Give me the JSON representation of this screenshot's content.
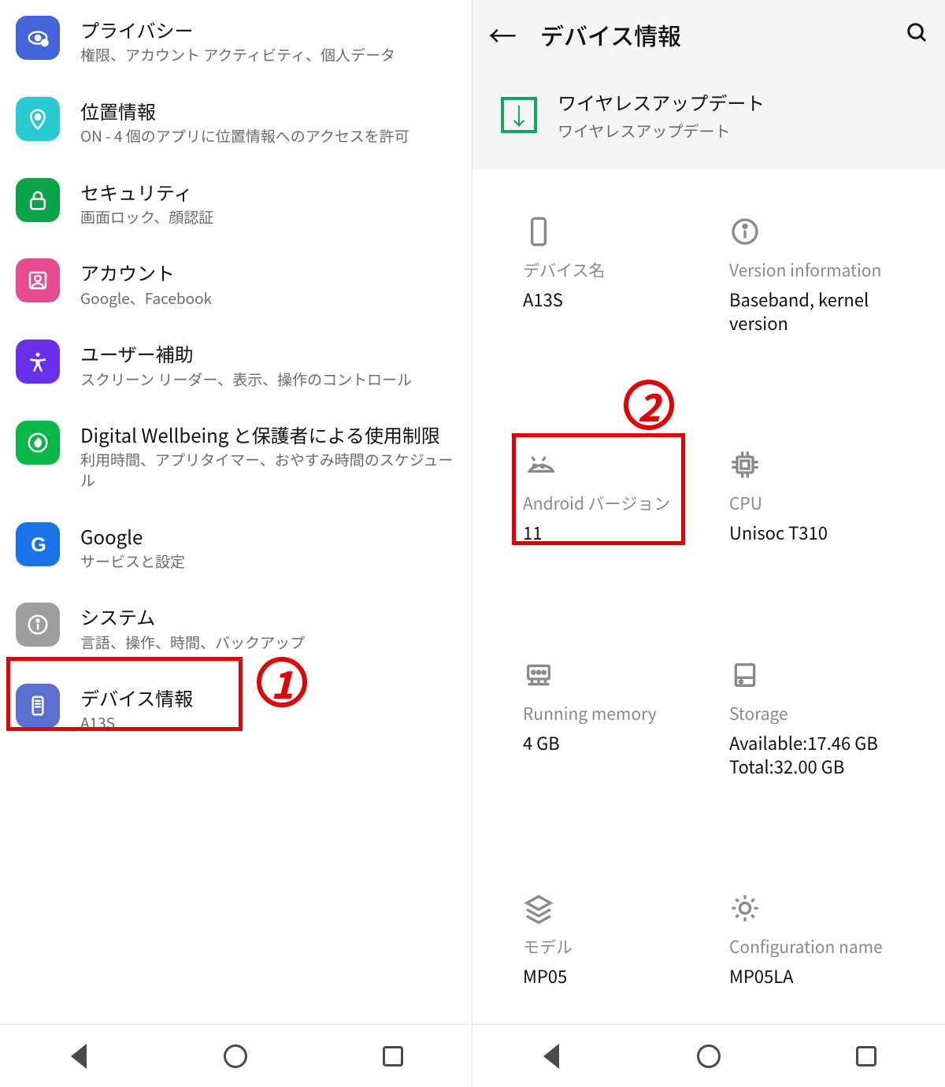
{
  "left": {
    "items": [
      {
        "title": "プライバシー",
        "sub": "権限、アカウント アクティビティ、個人データ",
        "color": "bg-blue",
        "icon": "eye"
      },
      {
        "title": "位置情報",
        "sub": "ON - 4 個のアプリに位置情報へのアクセスを許可",
        "color": "bg-cyan",
        "icon": "pin"
      },
      {
        "title": "セキュリティ",
        "sub": "画面ロック、顔認証",
        "color": "bg-green",
        "icon": "lock"
      },
      {
        "title": "アカウント",
        "sub": "Google、Facebook",
        "color": "bg-pink",
        "icon": "person"
      },
      {
        "title": "ユーザー補助",
        "sub": "スクリーン リーダー、表示、操作のコントロール",
        "color": "bg-violet",
        "icon": "a11y"
      },
      {
        "title": "Digital Wellbeing と保護者による使用制限",
        "sub": "利用時間、アプリタイマー、おやすみ時間のスケジュール",
        "color": "bg-lime",
        "icon": "well"
      },
      {
        "title": "Google",
        "sub": "サービスと設定",
        "color": "bg-gblue",
        "icon": "g"
      },
      {
        "title": "システム",
        "sub": "言語、操作、時間、バックアップ",
        "color": "bg-grey",
        "icon": "info"
      },
      {
        "title": "デバイス情報",
        "sub": "A13S",
        "color": "bg-indigo",
        "icon": "device"
      }
    ],
    "highlight_index": 8,
    "marker": "1"
  },
  "right": {
    "header_title": "デバイス情報",
    "wireless": {
      "title": "ワイヤレスアップデート",
      "sub": "ワイヤレスアップデート"
    },
    "cards": [
      {
        "icon": "phone",
        "label": "デバイス名",
        "val": "A13S"
      },
      {
        "icon": "info",
        "label": "Version information",
        "val": "Baseband, kernel version"
      },
      {
        "icon": "android",
        "label": "Android バージョン",
        "val": "11"
      },
      {
        "icon": "cpu",
        "label": "CPU",
        "val": "Unisoc T310"
      },
      {
        "icon": "ram",
        "label": "Running memory",
        "val": "4 GB"
      },
      {
        "icon": "storage",
        "label": "Storage",
        "val": "Available:17.46 GB\nTotal:32.00 GB"
      },
      {
        "icon": "layers",
        "label": "モデル",
        "val": "MP05"
      },
      {
        "icon": "cfg",
        "label": "Configuration name",
        "val": "MP05LA"
      }
    ],
    "highlight_index": 2,
    "marker": "2"
  }
}
